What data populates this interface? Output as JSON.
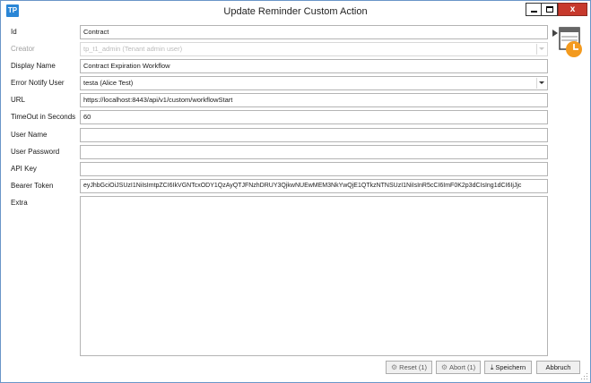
{
  "window": {
    "app_icon": "TP",
    "title": "Update Reminder Custom Action",
    "close_glyph": "x"
  },
  "form": {
    "id": {
      "label": "Id",
      "value": "Contract"
    },
    "creator": {
      "label": "Creator",
      "value": "tp_t1_admin (Tenant admin user)"
    },
    "display_name": {
      "label": "Display Name",
      "value": "Contract Expiration Workflow"
    },
    "error_notify_user": {
      "label": "Error Notify User",
      "value": "testa (Alice Test)"
    },
    "url": {
      "label": "URL",
      "value": "https://localhost:8443/api/v1/custom/workflowStart"
    },
    "timeout": {
      "label": "TimeOut in Seconds",
      "value": "60"
    },
    "user_name": {
      "label": "User Name",
      "value": ""
    },
    "user_password": {
      "label": "User Password",
      "value": ""
    },
    "api_key": {
      "label": "API Key",
      "value": ""
    },
    "bearer_token": {
      "label": "Bearer Token",
      "value": "eyJhbGciOiJSUzI1NiIsImtpZCI6IkVGNTcxODY1QzAyQTJFNzhDRUY3QjkwNUEwMEM3NkYwQjE1QTkzNTNSUzI1NiIsInR5cCI6ImF0K2p3dCIsIng1dCI6IjJjc"
    },
    "extra": {
      "label": "Extra",
      "value": ""
    }
  },
  "buttons": {
    "reset": "Reset (1)",
    "abort": "Abort (1)",
    "save": "Speichern",
    "cancel": "Abbruch"
  },
  "icons": {
    "app": "app-logo-icon",
    "action": "scheduled-action-icon",
    "reset": "gear-icon",
    "abort": "gear-icon",
    "save": "save-icon"
  },
  "colors": {
    "accent": "#2a86d6",
    "close": "#c7392c",
    "clock": "#f39a1e"
  }
}
